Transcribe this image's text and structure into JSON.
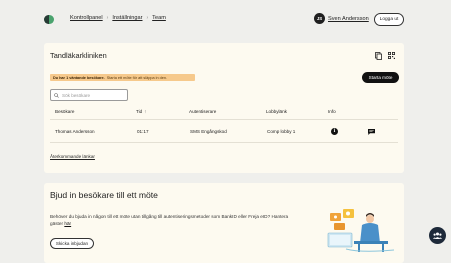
{
  "breadcrumb": [
    "Kontrollpanel",
    "Inställningar",
    "Team"
  ],
  "user": {
    "initials": "JS",
    "name": "Sven Andersson"
  },
  "header": {
    "logout_label": "Logga ut"
  },
  "clinic": {
    "title": "Tandläkarkliniken",
    "banner_bold": "Du har 1 väntande besökare.",
    "banner_text": "Starta ett möte för att släppa in den.",
    "start_meeting_label": "Starta möte",
    "search_placeholder": "Sök besökare",
    "columns": [
      "Besökare",
      "Tid",
      "Autentiserare",
      "Lobbylänk",
      "Info"
    ],
    "rows": [
      {
        "visitor": "Thomas Andersson",
        "time": "01:17",
        "auth": "SMS Engångskod",
        "lobby": "Comp lobby 1"
      }
    ],
    "recurring_link": "Återkommande länkar"
  },
  "invite": {
    "title": "Bjud in besökare till ett möte",
    "text": "Behöver du bjuda in någon till ett möte utan tillgång till autentiseringsmetoder som BankID eller Freja eID? Hantera gäster",
    "text_link": "här",
    "button_label": "Skicka inbjudan"
  },
  "colors": {
    "accent_green": "#4aa36e",
    "banner": "#f6c98c",
    "card": "#fdfaf0",
    "fab": "#1e2a3a"
  },
  "icons": [
    "copy-icon",
    "qr-code-icon",
    "search-icon",
    "sort-arrow-icon",
    "info-icon",
    "chat-icon",
    "team-icon"
  ]
}
